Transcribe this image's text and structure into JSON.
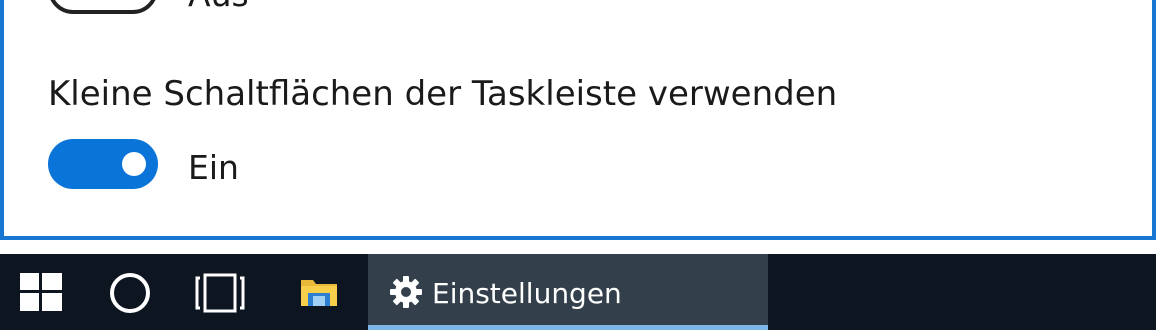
{
  "settings": {
    "prev_toggle": {
      "state_label": "Aus",
      "on": false
    },
    "small_buttons": {
      "title": "Kleine Schaltflächen der Taskleiste verwenden",
      "state_label": "Ein",
      "on": true
    }
  },
  "taskbar": {
    "start_icon": "windows-logo-icon",
    "search_icon": "cortana-circle-icon",
    "taskview_icon": "task-view-icon",
    "explorer_icon": "file-explorer-folder-icon",
    "active_app": {
      "icon": "gear-icon",
      "label": "Einstellungen"
    }
  },
  "colors": {
    "accent": "#0a74d9",
    "window_border": "#1976d2",
    "taskbar_bg": "#0d1620",
    "active_app_bg": "#333f4a",
    "active_underline": "#7cb6e8"
  }
}
